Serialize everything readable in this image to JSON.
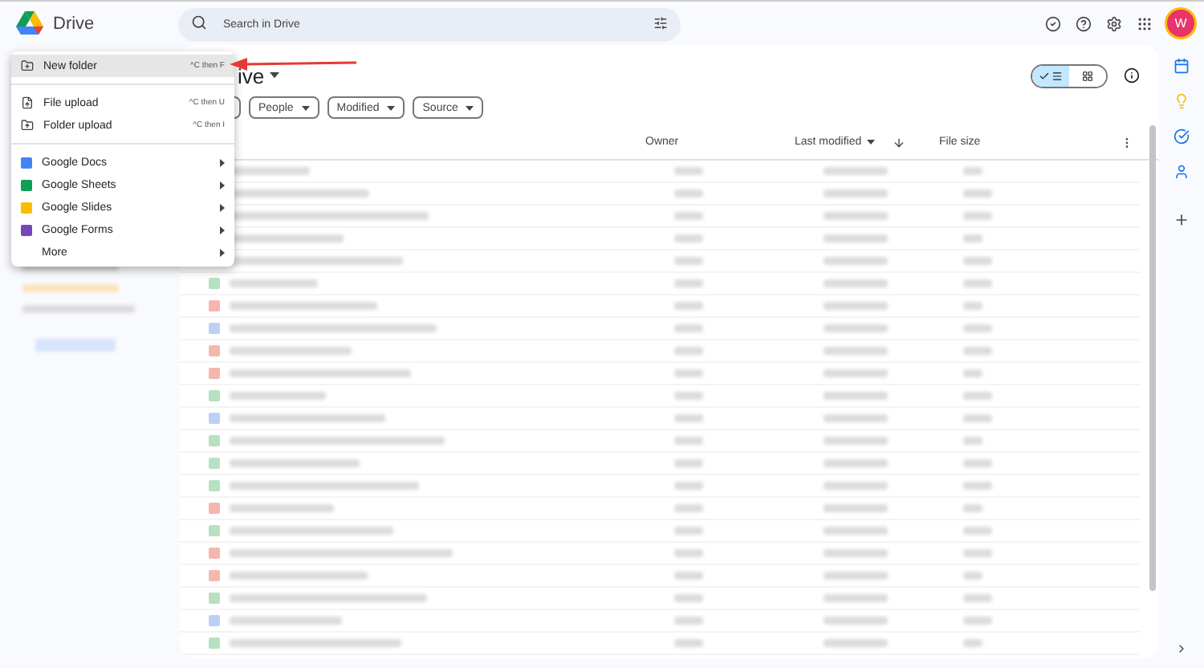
{
  "app": {
    "name": "Drive"
  },
  "search": {
    "placeholder": "Search in Drive"
  },
  "account": {
    "initial": "W"
  },
  "page_title": "ive",
  "filters": [
    "People",
    "Modified",
    "Source"
  ],
  "view_toggle": [
    {
      "kind": "list",
      "selected": true
    },
    {
      "kind": "grid",
      "selected": false
    }
  ],
  "columns": {
    "owner": "Owner",
    "last_modified": "Last modified",
    "file_size": "File size"
  },
  "menu": {
    "groups": [
      [
        {
          "label": "New folder",
          "shortcut": "^C then F",
          "kind": "folder",
          "submenu": false,
          "selected": true
        }
      ],
      [
        {
          "label": "File upload",
          "shortcut": "^C then U",
          "kind": "file-upload",
          "submenu": false,
          "selected": false
        },
        {
          "label": "Folder upload",
          "shortcut": "^C then I",
          "kind": "folder-upload",
          "submenu": false,
          "selected": false
        }
      ],
      [
        {
          "label": "Google Docs",
          "kind": "docs",
          "submenu": true,
          "selected": false
        },
        {
          "label": "Google Sheets",
          "kind": "sheets",
          "submenu": true,
          "selected": false
        },
        {
          "label": "Google Slides",
          "kind": "slides",
          "submenu": true,
          "selected": false
        },
        {
          "label": "Google Forms",
          "kind": "forms",
          "submenu": true,
          "selected": false
        },
        {
          "label": "More",
          "kind": "plain",
          "submenu": true,
          "selected": false
        }
      ]
    ]
  },
  "rows": [
    {
      "kind": "covered"
    },
    {
      "kind": "covered"
    },
    {
      "kind": "covered"
    },
    {
      "kind": "covered"
    },
    {
      "kind": "covered"
    },
    {
      "kind": "file",
      "color": "#b7e1c1"
    },
    {
      "kind": "file",
      "color": "#f6b6b0"
    },
    {
      "kind": "file",
      "color": "#bcd0f7"
    },
    {
      "kind": "file",
      "color": "#f6b6b0"
    },
    {
      "kind": "file",
      "color": "#f6b6b0"
    },
    {
      "kind": "file",
      "color": "#b7e1c1"
    },
    {
      "kind": "file",
      "color": "#bcd0f7"
    },
    {
      "kind": "file",
      "color": "#b7e1c1"
    },
    {
      "kind": "file",
      "color": "#b7e1c1"
    },
    {
      "kind": "file",
      "color": "#b7e1c1"
    },
    {
      "kind": "file",
      "color": "#f6b6b0"
    },
    {
      "kind": "file",
      "color": "#b7e1c1"
    },
    {
      "kind": "file",
      "color": "#f6b6b0"
    },
    {
      "kind": "file",
      "color": "#f6b6b0"
    },
    {
      "kind": "file",
      "color": "#b7e1c1"
    },
    {
      "kind": "file",
      "color": "#bcd0f7"
    },
    {
      "kind": "file",
      "color": "#b7e1c1"
    }
  ]
}
